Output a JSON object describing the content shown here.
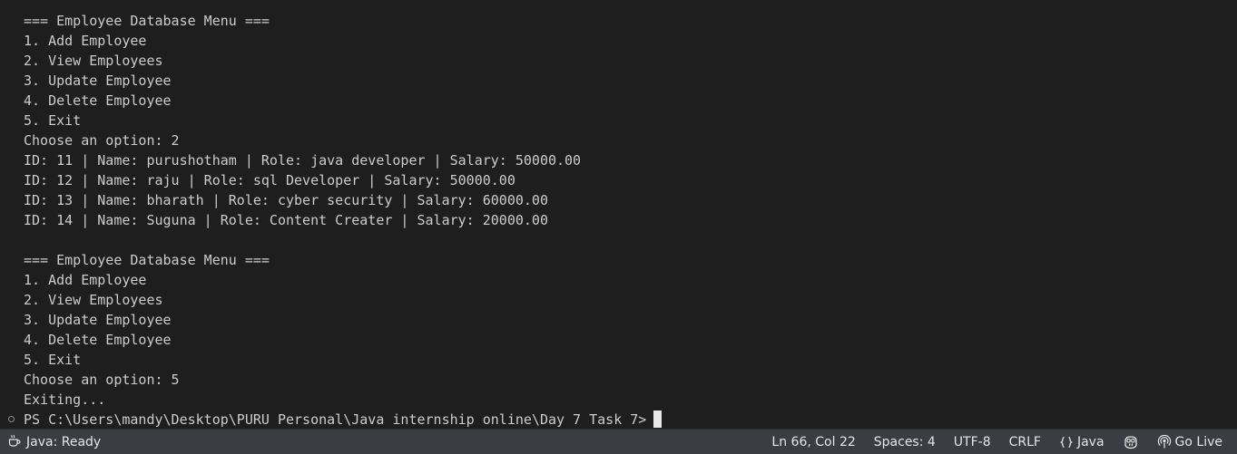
{
  "terminal": {
    "lines": [
      "=== Employee Database Menu ===",
      "1. Add Employee",
      "2. View Employees",
      "3. Update Employee",
      "4. Delete Employee",
      "5. Exit",
      "Choose an option: 2",
      "ID: 11 | Name: purushotham | Role: java developer | Salary: 50000.00",
      "ID: 12 | Name: raju | Role: sql Developer | Salary: 50000.00",
      "ID: 13 | Name: bharath | Role: cyber security | Salary: 60000.00",
      "ID: 14 | Name: Suguna | Role: Content Creater | Salary: 20000.00",
      "",
      "=== Employee Database Menu ===",
      "1. Add Employee",
      "2. View Employees",
      "3. Update Employee",
      "4. Delete Employee",
      "5. Exit",
      "Choose an option: 5",
      "Exiting..."
    ],
    "prompt": "PS C:\\Users\\mandy\\Desktop\\PURU Personal\\Java internship online\\Day 7 Task 7>"
  },
  "statusbar": {
    "java_status": "Java: Ready",
    "cursor_position": "Ln 66, Col 22",
    "indentation": "Spaces: 4",
    "encoding": "UTF-8",
    "line_endings": "CRLF",
    "language": "Java",
    "go_live": "Go Live",
    "icons": {
      "java_status": "coffee-cup-icon",
      "language": "braces-icon",
      "copilot": "copilot-icon",
      "go_live": "broadcast-icon"
    }
  },
  "colors": {
    "terminal_bg": "#1e1e1e",
    "terminal_text": "#cccccc",
    "statusbar_bg": "#3a3d41",
    "statusbar_text": "#e6e6e6"
  }
}
